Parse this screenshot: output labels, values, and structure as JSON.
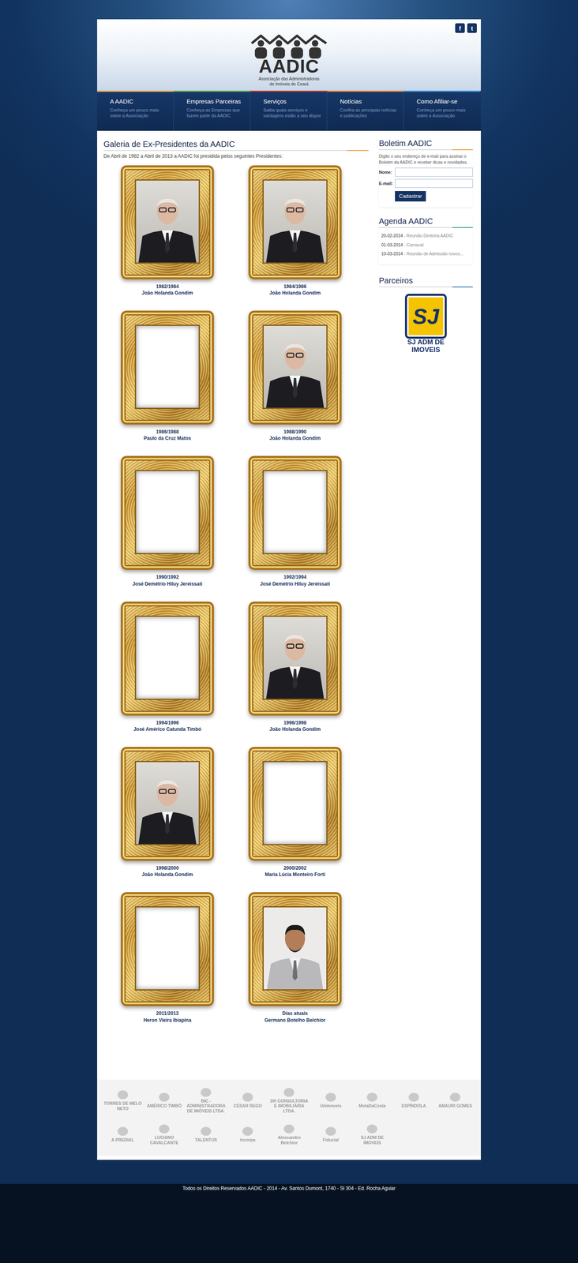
{
  "header": {
    "social": [
      "f",
      "t"
    ],
    "logo": {
      "title": "AADIC",
      "subtitle_lines": [
        "Associação das Administradoras",
        "de Imóveis do Ceará"
      ]
    }
  },
  "nav": [
    {
      "title": "A AADIC",
      "desc": "Conheça um pouco mais sobre a Associação",
      "color": "#e8a33d"
    },
    {
      "title": "Empresas Parceiras",
      "desc": "Conheça as Empresas que fazem parte da AADIC",
      "color": "#5aa84a"
    },
    {
      "title": "Serviços",
      "desc": "Saiba quais serviços e vantagens estão a seu dispor",
      "color": "#c0392b"
    },
    {
      "title": "Notícias",
      "desc": "Confira as principais notícias e publicações",
      "color": "#e67e22"
    },
    {
      "title": "Como Afiliar-se",
      "desc": "Conheça um pouco mais sobre a Associação",
      "color": "#3a8fd0"
    }
  ],
  "gallery": {
    "title": "Galeria de Ex-Presidentes da AADIC",
    "intro": "De Abril de 1982 a Abril de 2013 a AADIC foi presidida pelos seguintes Presidentes:",
    "presidents": [
      {
        "period": "1982/1984",
        "name": "João Holanda Gondim",
        "kind": "portrait"
      },
      {
        "period": "1984/1986",
        "name": "João Holanda Gondim",
        "kind": "portrait"
      },
      {
        "period": "1986/1988",
        "name": "Paulo da Cruz Matos",
        "kind": "empty"
      },
      {
        "period": "1988/1990",
        "name": "João Holanda Gondim",
        "kind": "portrait"
      },
      {
        "period": "1990/1992",
        "name": "José Demétrio Hiluy Jereissati",
        "kind": "empty"
      },
      {
        "period": "1992/1994",
        "name": "José Demétrio Hiluy Jereissati",
        "kind": "empty"
      },
      {
        "period": "1994/1996",
        "name": "José Américo Catunda Timbó",
        "kind": "empty"
      },
      {
        "period": "1996/1998",
        "name": "João Holanda Gondim",
        "kind": "portrait"
      },
      {
        "period": "1998/2000",
        "name": "João Holanda Gondim",
        "kind": "portrait"
      },
      {
        "period": "2000/2002",
        "name": "Maria Lúcia Monteiro Forti",
        "kind": "empty"
      },
      {
        "period": "2011/2013",
        "name": "Heron Vieira Ibiapina",
        "kind": "empty"
      },
      {
        "period": "Dias atuais",
        "name": "Germano Botelho Belchior",
        "kind": "portrait-alt"
      }
    ]
  },
  "sidebar": {
    "newsletter": {
      "title": "Boletim AADIC",
      "text": "Digite o seu endereço de e-mail para assinar o Boletim da AADIC e receber dicas e novidades.",
      "name_label": "Nome:",
      "email_label": "E-mail:",
      "button": "Cadastrar"
    },
    "agenda": {
      "title": "Agenda AADIC",
      "items": [
        {
          "date": "20-02-2014",
          "text": " - Reunião Diretoria AADIC"
        },
        {
          "date": "01-03-2014",
          "text": " - Carnaval"
        },
        {
          "date": "10-03-2014",
          "text": " - Reunião de Admissão novos..."
        }
      ]
    },
    "partners": {
      "title": "Parceiros",
      "mark": "SJ",
      "lines": [
        "SJ ADM DE",
        "IMOVEIS"
      ]
    }
  },
  "partners_strip": [
    "TORRES DE MELO NETO",
    "AMÉRICO TIMBÓ",
    "BIC - ADMINISTRADORA DE IMÓVEIS LTDA.",
    "CÉSAR REGO",
    "DH CONSULTORIA E IMOBILIÁRIA LTDA.",
    "Unimóveis",
    "MotaDaCosta",
    "ESPÍNDOLA",
    "AMAURI GOMES",
    "A PREDIAL",
    "LUCIANO CAVALCANTE",
    "TALENTUS",
    "incorpa",
    "Alessandro Belchior",
    "Fiducial",
    "SJ ADM DE IMOVEIS"
  ],
  "footer": "Todos os Direitos Reservados AADIC - 2014 - Av. Santos Dumont, 1740 - Sl 304 - Ed. Rocha Aguiar"
}
